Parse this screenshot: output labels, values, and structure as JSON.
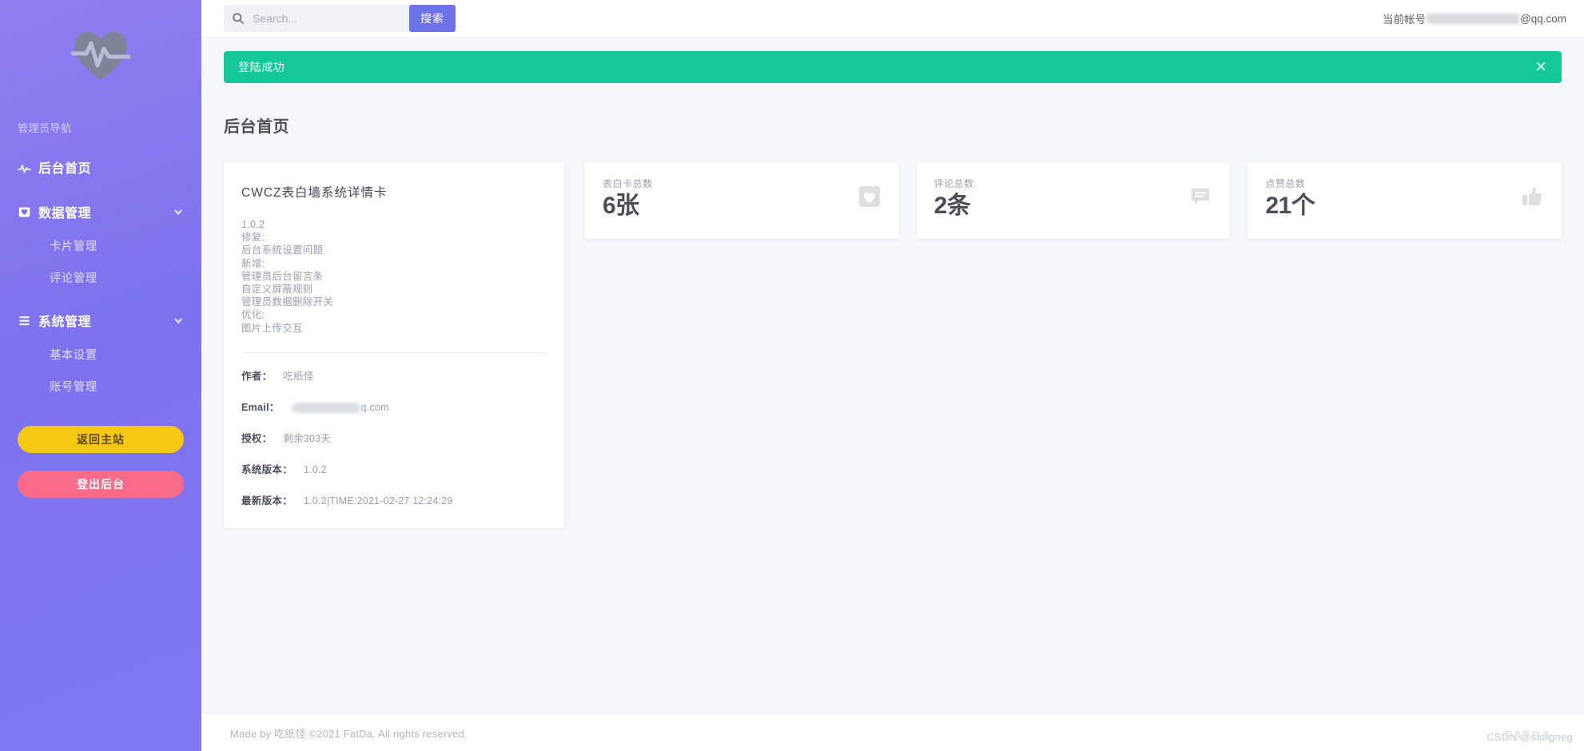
{
  "sidebar": {
    "logo_icon": "heartbeat-logo-icon",
    "nav_title": "管理员导航",
    "items": [
      {
        "label": "后台首页",
        "icon": "activity-icon",
        "has_chevron": false
      },
      {
        "label": "数据管理",
        "icon": "card-heart-icon",
        "has_chevron": true
      },
      {
        "label": "系统管理",
        "icon": "list-lines-icon",
        "has_chevron": true
      }
    ],
    "sub_data": [
      {
        "label": "卡片管理"
      },
      {
        "label": "评论管理"
      }
    ],
    "sub_system": [
      {
        "label": "基本设置"
      },
      {
        "label": "账号管理"
      }
    ],
    "home_button": "返回主站",
    "logout_button": "登出后台",
    "colors": {
      "background_start": "#8f7ef0",
      "background_end": "#7f78f0",
      "home_button": "#f6c715",
      "logout_button": "#fa6b8a"
    }
  },
  "topbar": {
    "search_placeholder": "Search...",
    "search_value": "",
    "search_button": "搜索",
    "search_icon": "search-icon",
    "account_prefix": "当前帐号",
    "account_suffix": "@qq.com",
    "account_redacted": true,
    "search_button_color": "#6d72e8"
  },
  "alert": {
    "message": "登陆成功",
    "close_label": "✕",
    "color": "#14c89a"
  },
  "page": {
    "title": "后台首页"
  },
  "info_card": {
    "title": "CWCZ表白墙系统详情卡",
    "changelog": [
      "1.0.2",
      "修复:",
      "后台系统设置问题",
      "新增:",
      "管理员后台留言条",
      "自定义屏蔽规则",
      "管理员数据删除开关",
      "优化:",
      "图片上传交互"
    ],
    "details": [
      {
        "key": "作者：",
        "value": "吃纸怪",
        "redacted": false
      },
      {
        "key": "Email：",
        "value_prefix": "",
        "value_suffix": "q.com",
        "redacted": true
      },
      {
        "key": "授权：",
        "value": "剩余303天",
        "redacted": false
      },
      {
        "key": "系统版本：",
        "value": "1.0.2",
        "redacted": false
      },
      {
        "key": "最新版本：",
        "value": "1.0.2|TIME:2021-02-27 12:24:29",
        "redacted": false
      }
    ]
  },
  "stats": [
    {
      "label": "表白卡总数",
      "value": "6张",
      "icon": "heart-square-icon"
    },
    {
      "label": "评论总数",
      "value": "2条",
      "icon": "comment-icon"
    },
    {
      "label": "点赞总数",
      "value": "21个",
      "icon": "thumbs-up-icon"
    }
  ],
  "footer": {
    "text": "Made by 吃纸怪 ©2021 FatDa. All rights reserved.",
    "watermark": "CSDN @stdfgneg",
    "watermark_back": "FATDA"
  }
}
